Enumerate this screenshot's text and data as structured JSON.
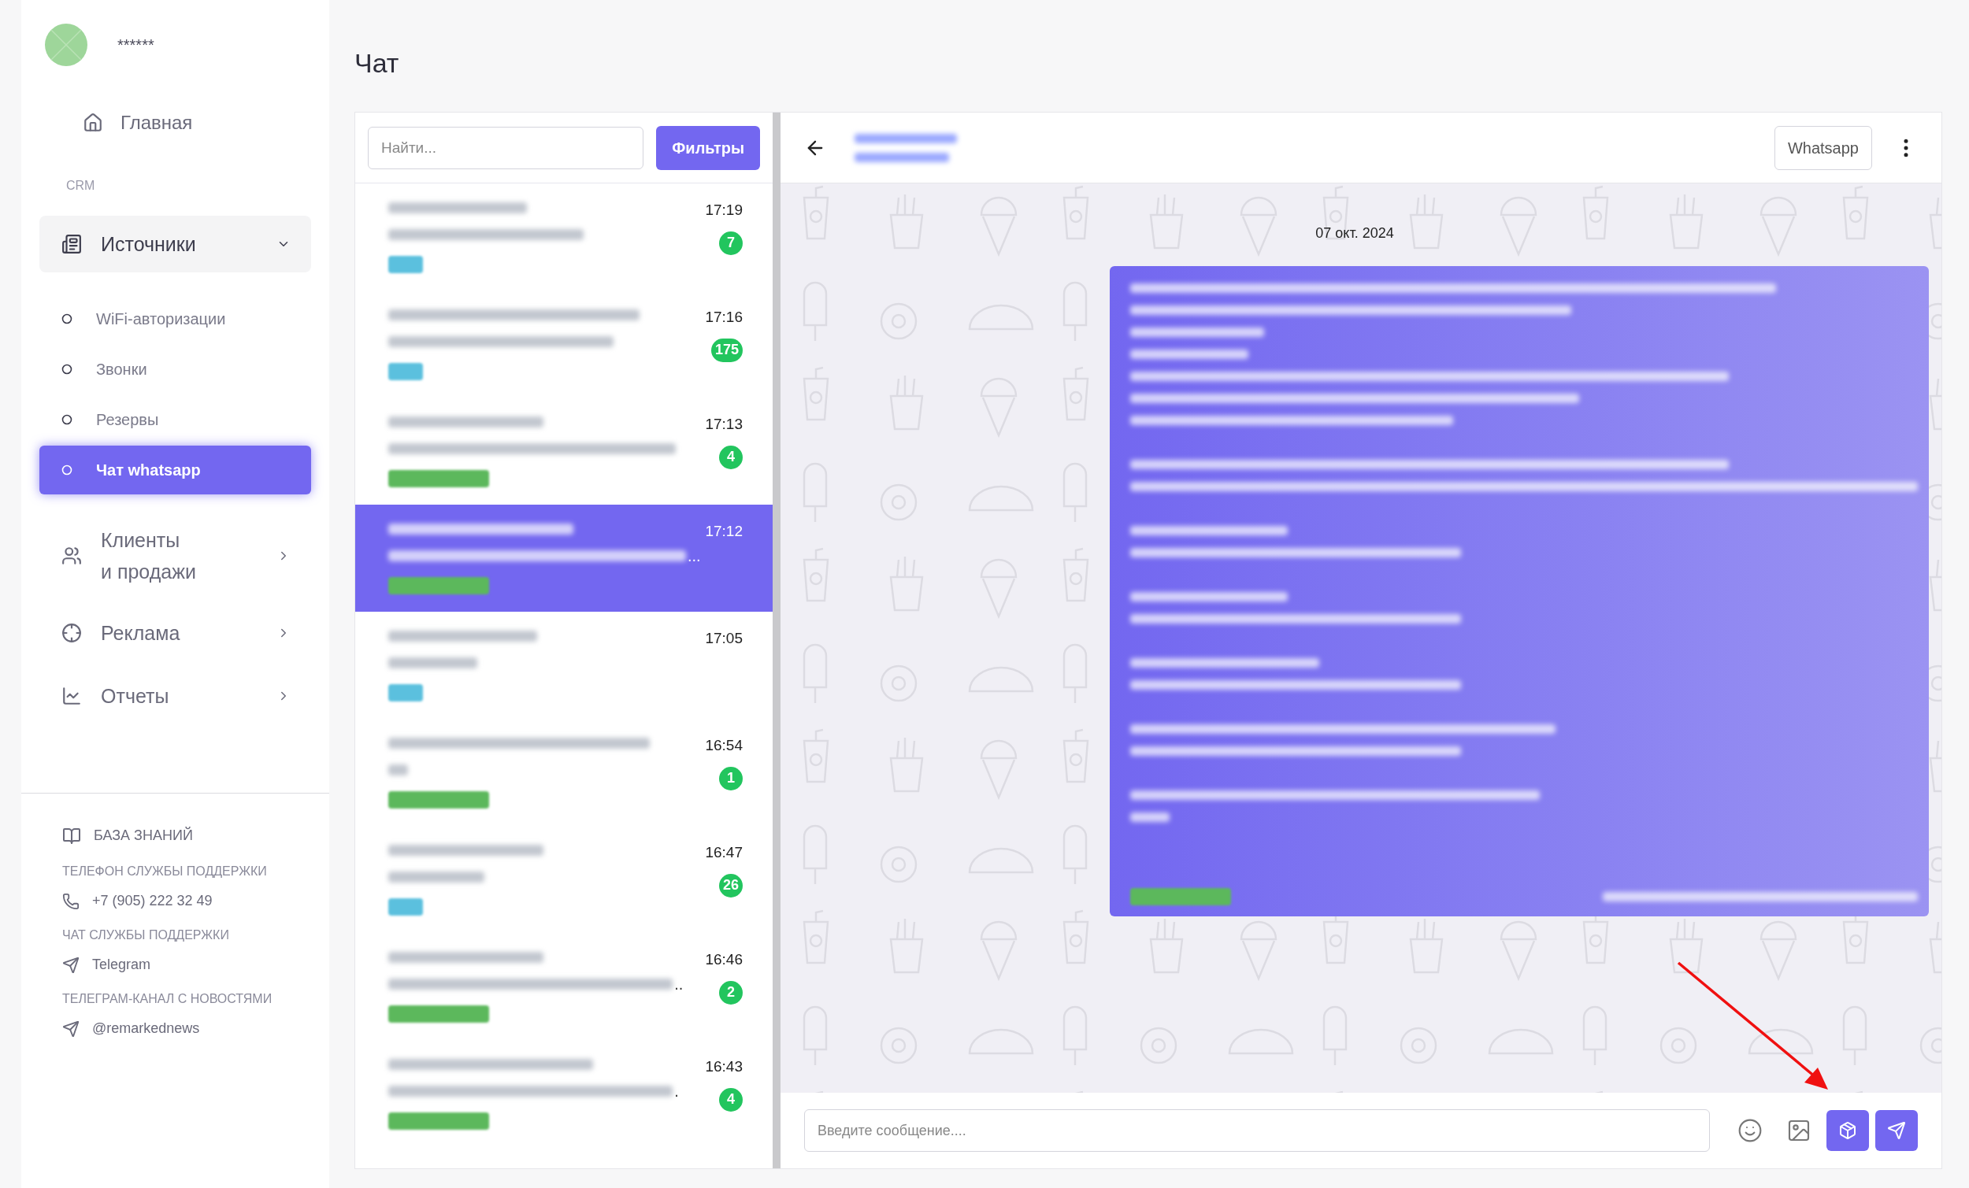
{
  "user": {
    "name": "******"
  },
  "nav": [
    {
      "kind": "link",
      "label": "Главная"
    },
    {
      "kind": "section",
      "label": "CRM"
    },
    {
      "kind": "group",
      "label": "Источники",
      "expanded": true,
      "children": [
        {
          "label": "WiFi-авторизации",
          "selected": false
        },
        {
          "label": "Звонки",
          "selected": false
        },
        {
          "label": "Резервы",
          "selected": false
        },
        {
          "label": "Чат whatsapp",
          "selected": true
        }
      ]
    },
    {
      "kind": "group",
      "label": "Клиенты\nи продажи",
      "expanded": false
    },
    {
      "kind": "group",
      "label": "Реклама",
      "expanded": false
    },
    {
      "kind": "group",
      "label": "Отчеты",
      "expanded": false
    }
  ],
  "support": [
    {
      "kind": "link",
      "label": "БАЗА ЗНАНИЙ"
    },
    {
      "kind": "contact",
      "heading": "ТЕЛЕФОН СЛУЖБЫ ПОДДЕРЖКИ",
      "label": "+7 (905) 222 32 49"
    },
    {
      "kind": "contact",
      "heading": "ЧАТ СЛУЖБЫ ПОДДЕРЖКИ",
      "label": "Telegram"
    },
    {
      "kind": "contact",
      "heading": "ТЕЛЕГРАМ-КАНАЛ С НОВОСТЯМИ",
      "label": "@remarkednews"
    }
  ],
  "page_title": "Чат",
  "search": {
    "placeholder": "Найти..."
  },
  "filters_button": "Фильтры",
  "chats": [
    {
      "time": "17:19",
      "unread": "7",
      "color": "#5bc0de",
      "selected": false
    },
    {
      "time": "17:16",
      "unread": "175",
      "color": "#5bc0de",
      "selected": false
    },
    {
      "time": "17:13",
      "unread": "4",
      "color": "#5cb85c",
      "selected": false
    },
    {
      "time": "17:12",
      "preview_tail": "...",
      "color": "#5cb85c",
      "selected": true
    },
    {
      "time": "17:05",
      "color": "#5bc0de",
      "selected": false
    },
    {
      "time": "16:54",
      "unread": "1",
      "color": "#5cb85c",
      "selected": false
    },
    {
      "time": "16:47",
      "unread": "26",
      "color": "#5bc0de",
      "selected": false
    },
    {
      "time": "16:46",
      "unread": "2",
      "preview_tail": "..",
      "color": "#5cb85c",
      "selected": false
    },
    {
      "time": "16:43",
      "unread": "4",
      "preview_tail": ".",
      "color": "#5cb85c",
      "selected": false
    }
  ],
  "conversation": {
    "channel_button": "Whatsapp",
    "date": "07 окт. 2024",
    "message": {
      "color": "#5cb85c"
    }
  },
  "composer": {
    "placeholder": "Введите сообщение....",
    "tools": [
      {
        "kind": "emoji",
        "selected": false
      },
      {
        "kind": "image",
        "selected": false
      },
      {
        "kind": "box",
        "selected": true
      },
      {
        "kind": "send",
        "selected": true
      }
    ]
  }
}
